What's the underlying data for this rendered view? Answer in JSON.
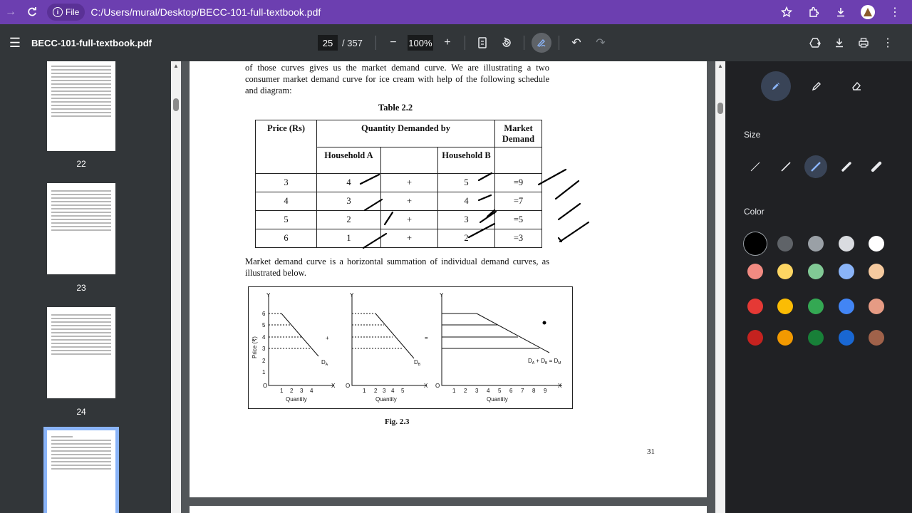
{
  "browser": {
    "file_chip": "File",
    "url": "C:/Users/mural/Desktop/BECC-101-full-textbook.pdf"
  },
  "toolbar": {
    "title": "BECC-101-full-textbook.pdf",
    "page_current": "25",
    "page_total": "/ 357",
    "zoom": "100%"
  },
  "thumbnails": [
    {
      "label": "22"
    },
    {
      "label": "23"
    },
    {
      "label": "24"
    },
    {
      "label": ""
    }
  ],
  "page": {
    "intro": "of those curves gives us the market demand curve. We are illustrating a two consumer market demand curve for ice cream with help of the following schedule and diagram:",
    "table_caption": "Table 2.2",
    "table": {
      "h_price": "Price (Rs)",
      "h_qty": "Quantity Demanded by",
      "h_market": "Market Demand",
      "h_hh_a": "Household A",
      "h_hh_b": "Household B",
      "rows": [
        {
          "price": "3",
          "a": "4",
          "plus": "+",
          "b": "5",
          "market": "=9"
        },
        {
          "price": "4",
          "a": "3",
          "plus": "+",
          "b": "4",
          "market": "=7"
        },
        {
          "price": "5",
          "a": "2",
          "plus": "+",
          "b": "3",
          "market": "=5"
        },
        {
          "price": "6",
          "a": "1",
          "plus": "+",
          "b": "2",
          "market": "=3"
        }
      ]
    },
    "summary": "Market demand curve is a horizontal summation of individual demand curves, as illustrated below.",
    "figure": {
      "y": "Y",
      "x": "X",
      "origin": "O",
      "ylabel": "Price (₹)",
      "xlabel": "Quantity",
      "plus": "+",
      "equals": "=",
      "da": "D",
      "da_sub": "A",
      "db": "D",
      "db_sub": "B",
      "dm": "D",
      "dm_a": "A",
      "dm_b": "B",
      "dm_m": "M",
      "dm_plus": " + ",
      "dm_eq": " = ",
      "y_ticks": [
        "6",
        "5",
        "4",
        "3",
        "2",
        "1"
      ],
      "x_ticks_a": [
        "1",
        "2",
        "3",
        "4"
      ],
      "x_ticks_b": [
        "1",
        "2",
        "3",
        "4",
        "5"
      ],
      "x_ticks_m": [
        "1",
        "2",
        "3",
        "4",
        "5",
        "6",
        "7",
        "8",
        "9"
      ]
    },
    "fig_caption": "Fig. 2.3",
    "page_number": "31"
  },
  "annotation": {
    "size_label": "Size",
    "color_label": "Color",
    "colors": [
      "#000000",
      "#5f6368",
      "#9aa0a6",
      "#dadce0",
      "#ffffff",
      "#f28b82",
      "#fdd663",
      "#81c995",
      "#8ab4f8",
      "#f6ca9f",
      "#e53935",
      "#fbbc04",
      "#34a853",
      "#4285f4",
      "#e69b84",
      "#c5221f",
      "#f29900",
      "#188038",
      "#1967d2",
      "#a0624a"
    ],
    "selected_color": "#000000"
  }
}
